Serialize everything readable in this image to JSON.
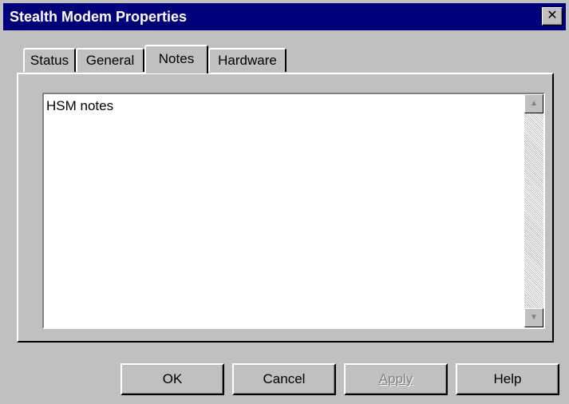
{
  "window": {
    "title": "Stealth Modem Properties",
    "close_glyph": "✕"
  },
  "tabs": [
    {
      "label": "Status"
    },
    {
      "label": "General"
    },
    {
      "label": "Notes",
      "active": true
    },
    {
      "label": "Hardware"
    }
  ],
  "notes": {
    "value": "HSM notes"
  },
  "scrollbar": {
    "up_icon": "▲",
    "down_icon": "▼"
  },
  "buttons": {
    "ok": "OK",
    "cancel": "Cancel",
    "apply": "Apply",
    "help": "Help"
  },
  "colors": {
    "titlebar": "#00007b",
    "face": "#c0c0c0"
  }
}
